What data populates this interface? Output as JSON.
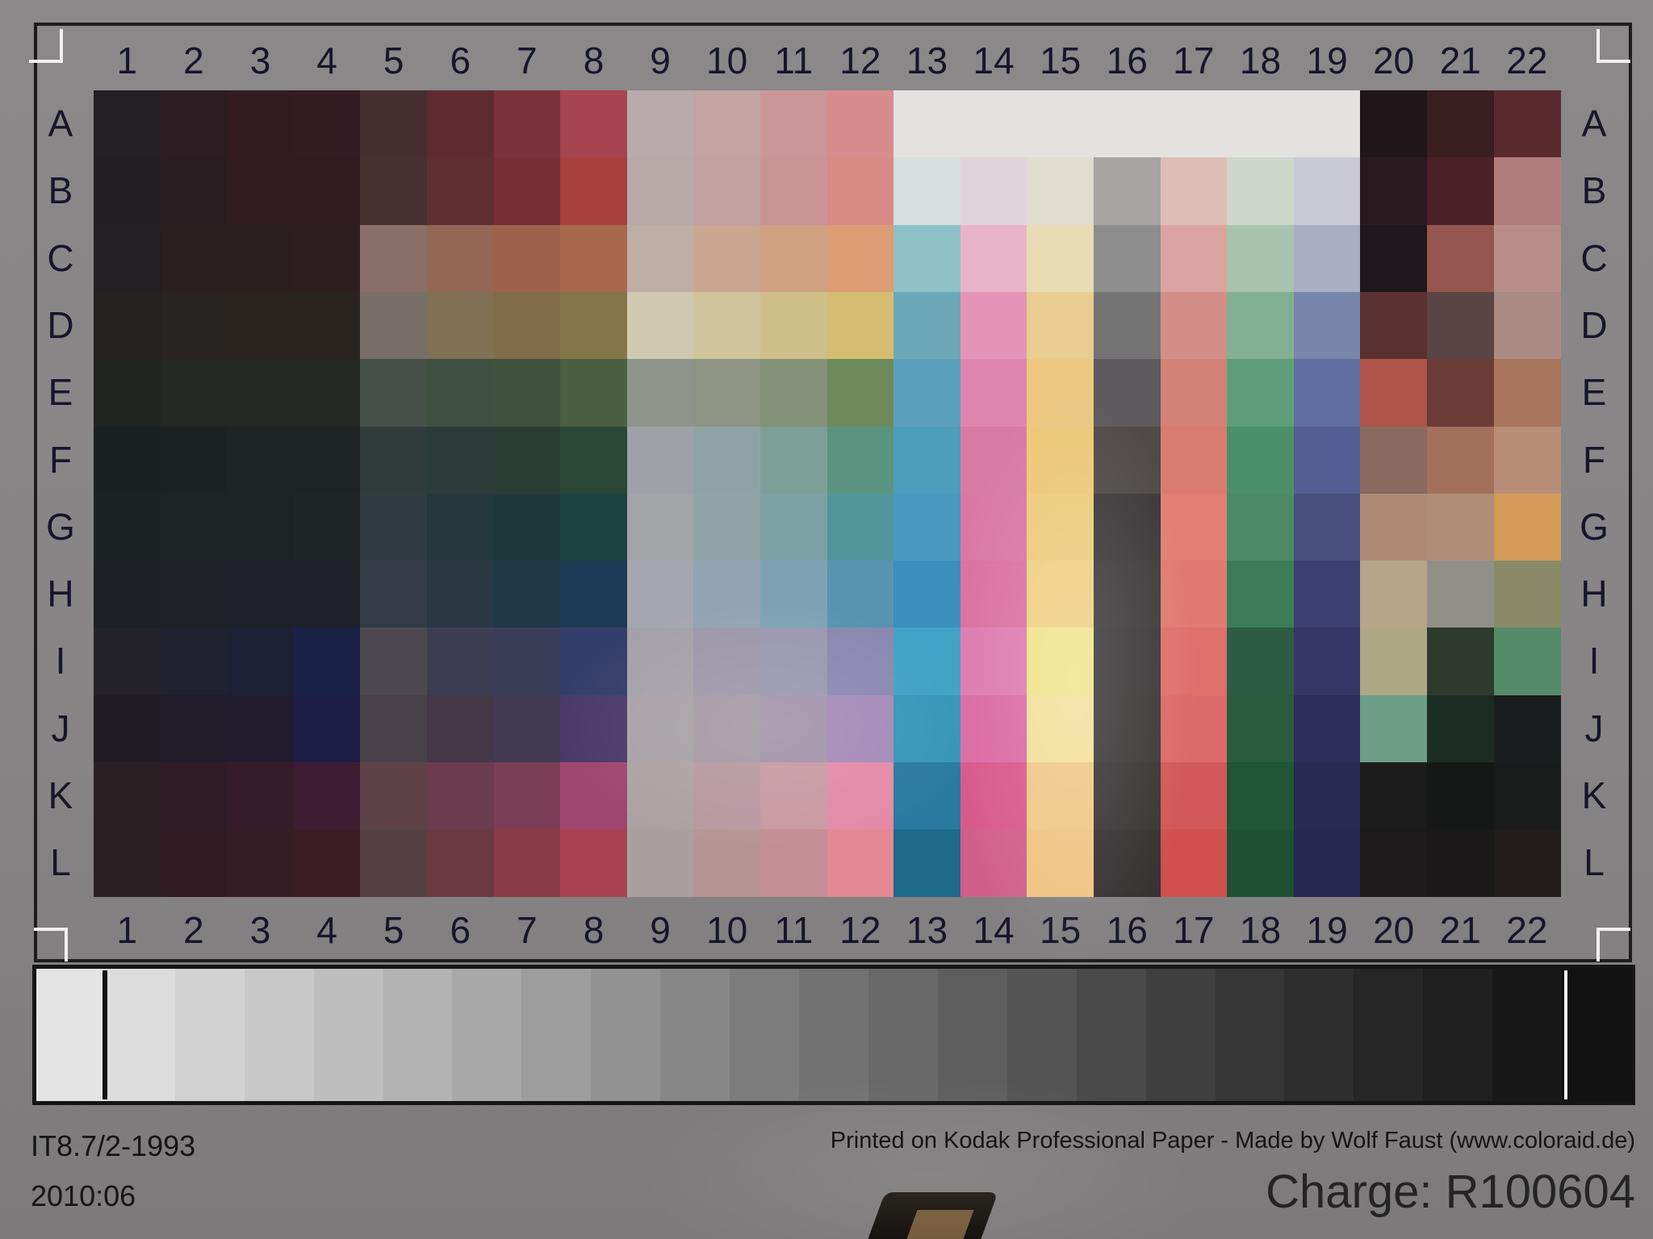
{
  "target": {
    "standard": "IT8.7/2-1993",
    "date": "2010:06",
    "credit": "Printed on Kodak Professional Paper  -  Made by Wolf Faust (www.coloraid.de)",
    "charge": "Charge: R100604",
    "columns": [
      "1",
      "2",
      "3",
      "4",
      "5",
      "6",
      "7",
      "8",
      "9",
      "10",
      "11",
      "12",
      "13",
      "14",
      "15",
      "16",
      "17",
      "18",
      "19",
      "20",
      "21",
      "22"
    ],
    "rows": [
      "A",
      "B",
      "C",
      "D",
      "E",
      "F",
      "G",
      "H",
      "I",
      "J",
      "K",
      "L"
    ],
    "patch_colors": [
      [
        "#241f24",
        "#2b1d22",
        "#321c22",
        "#341c22",
        "#462e30",
        "#5e2c30",
        "#7a323a",
        "#a64450",
        "#b9aaac",
        "#c3a4a3",
        "#cb9698",
        "#d88c8e",
        "#e4e2e0",
        "#e4e2e0",
        "#e4e2e0",
        "#e4e2e0",
        "#e4e2e0",
        "#e4e2e0",
        "#e4e2e0",
        "#1e1618",
        "#3a1e22",
        "#5a2a2e"
      ],
      [
        "#231e23",
        "#2a1d21",
        "#301c21",
        "#321c20",
        "#463030",
        "#5e2e30",
        "#782f34",
        "#a8403e",
        "#b8a8a8",
        "#c2a2a0",
        "#ca9494",
        "#d88a84",
        "#d6dede",
        "#e0d4da",
        "#e0dcd0",
        "#a8a4a4",
        "#dcbeb6",
        "#cfd6cc",
        "#c8cad4",
        "#281a1e",
        "#4a2126",
        "#b27c7c"
      ],
      [
        "#222022",
        "#282021",
        "#2c1f20",
        "#2e1f20",
        "#8a6e68",
        "#946656",
        "#9e624c",
        "#a8684c",
        "#beada4",
        "#c8a690",
        "#d0a080",
        "#dc9c74",
        "#8ec2c8",
        "#e8b4c8",
        "#e8dcb4",
        "#8e8e8e",
        "#dca4a0",
        "#a8c4ac",
        "#a8aec4",
        "#1e171c",
        "#94564e",
        "#b88e86"
      ],
      [
        "#232221",
        "#282422",
        "#2a2421",
        "#2a2420",
        "#787068",
        "#807054",
        "#806c48",
        "#847648",
        "#d0c8b0",
        "#d0c49c",
        "#cebe88",
        "#d4bc70",
        "#6ca8b8",
        "#e494b4",
        "#e8cc90",
        "#747474",
        "#d48e88",
        "#82b092",
        "#7886ac",
        "#5a3232",
        "#5a4544",
        "#ac8a84"
      ],
      [
        "#222422",
        "#242822",
        "#242822",
        "#242822",
        "#445048",
        "#3e5040",
        "#3e523c",
        "#4a6040",
        "#8e948a",
        "#8e9484",
        "#849278",
        "#6e8a5c",
        "#5aa0bc",
        "#de86b0",
        "#ecc880",
        "#5c5a5c",
        "#d48278",
        "#5e9e7a",
        "#5e6ea0",
        "#ae5448",
        "#6c3c36",
        "#a8745c"
      ],
      [
        "#1a2022",
        "#1c2224",
        "#1e2424",
        "#1e2424",
        "#303c3c",
        "#2c3c38",
        "#2a3e36",
        "#2a4636",
        "#9ea2a6",
        "#8ea4a4",
        "#7e9e98",
        "#5a9480",
        "#4c9cbc",
        "#d87aa4",
        "#ecc878",
        "#504a4a",
        "#d87c72",
        "#4c906a",
        "#545e94",
        "#8a6a5e",
        "#a4705e",
        "#b88e78"
      ],
      [
        "#1c2224",
        "#1c2426",
        "#1c2426",
        "#1e2628",
        "#303c40",
        "#26383c",
        "#1e383a",
        "#1e4240",
        "#a2a4a8",
        "#90a4a8",
        "#7ca0a4",
        "#50969a",
        "#4898c0",
        "#da78a4",
        "#eccc7c",
        "#3c3a3a",
        "#e27e74",
        "#4c8a66",
        "#48507e",
        "#ae8a74",
        "#ae8e78",
        "#d49a58"
      ],
      [
        "#1c2024",
        "#1e2226",
        "#1e2228",
        "#1e2228",
        "#343c48",
        "#2a3844",
        "#203848",
        "#1c3a54",
        "#a4a8ae",
        "#92a4b2",
        "#7ea2b4",
        "#5894b0",
        "#3c8ebc",
        "#da72a0",
        "#eed084",
        "#3e3c3c",
        "#e07a72",
        "#3c7c58",
        "#3c4070",
        "#b8a488",
        "#909088",
        "#8a8a68"
      ],
      [
        "#222228",
        "#202230",
        "#1e2034",
        "#1a2248",
        "#4c4a50",
        "#3e3e52",
        "#3a3e58",
        "#343e6a",
        "#a4a2a8",
        "#9c98a8",
        "#9a98b2",
        "#8a88b0",
        "#40a2c4",
        "#de7cb0",
        "#f0e48c",
        "#3c3a3a",
        "#de706c",
        "#2c5c44",
        "#343666",
        "#aca884",
        "#2e3a2c",
        "#548c6a"
      ],
      [
        "#201c24",
        "#201c2a",
        "#201c2e",
        "#1c1c44",
        "#484048",
        "#443848",
        "#423a52",
        "#4a3a6a",
        "#a8a2a6",
        "#a49aa4",
        "#a494ac",
        "#a48ab8",
        "#3896b8",
        "#da6ca4",
        "#f4e09c",
        "#3c3a38",
        "#dc6a6a",
        "#285c3c",
        "#2e2e5c",
        "#6e9e88",
        "#1c2c24",
        "#1a1e1e"
      ],
      [
        "#2a2024",
        "#301c24",
        "#361c2a",
        "#3e1c32",
        "#5e4248",
        "#6a3c4e",
        "#7a3e56",
        "#a0466e",
        "#aca2a4",
        "#b898a0",
        "#c89aa4",
        "#e48aa8",
        "#2a7aa0",
        "#d85a8a",
        "#f0c888",
        "#3a3634",
        "#d2585a",
        "#1e5636",
        "#282a52",
        "#1c1c1c",
        "#161818",
        "#1a1c1c"
      ],
      [
        "#2a2024",
        "#301c22",
        "#361c24",
        "#3c1c24",
        "#544042",
        "#6a3a40",
        "#8a3c46",
        "#a84252",
        "#aaa0a0",
        "#b69494",
        "#c48e94",
        "#e48892",
        "#1e6a8a",
        "#d0608a",
        "#f0c484",
        "#363232",
        "#d0504e",
        "#1e5034",
        "#262852",
        "#1c1a1a",
        "#1a1818",
        "#221c1c"
      ]
    ],
    "gray_scale_colors": [
      "#e4e4e4",
      "#dcdcdc",
      "#d2d2d2",
      "#c8c8c8",
      "#bebebe",
      "#b3b3b3",
      "#a8a8a8",
      "#9d9d9d",
      "#929292",
      "#878787",
      "#7c7c7c",
      "#727272",
      "#686868",
      "#5e5e5e",
      "#545454",
      "#4a4a4a",
      "#404040",
      "#363636",
      "#2e2e2e",
      "#262626",
      "#1f1f1f",
      "#181818",
      "#121212"
    ]
  }
}
